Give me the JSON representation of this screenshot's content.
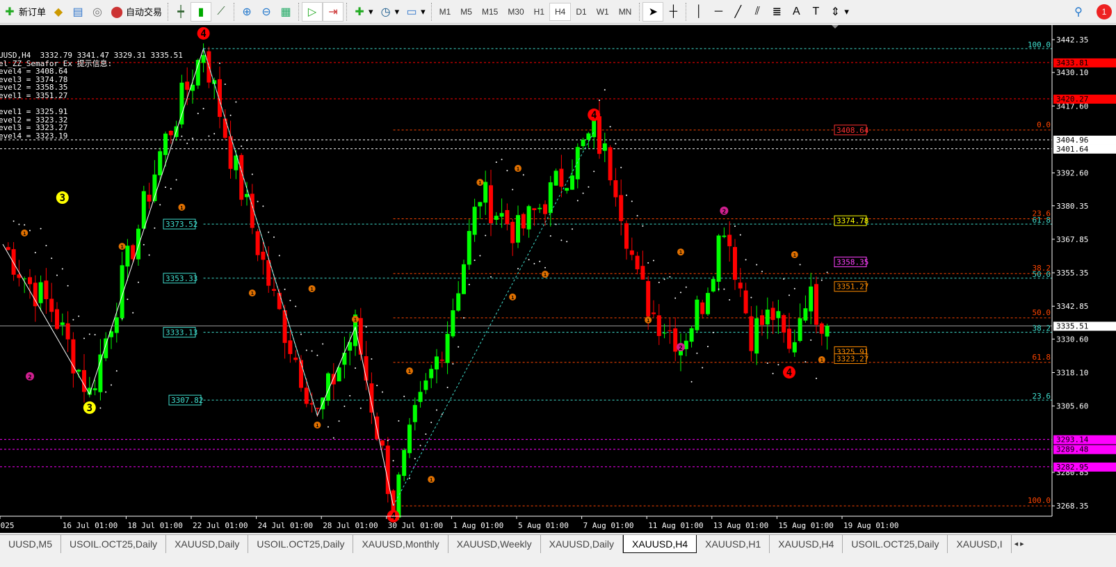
{
  "toolbar": {
    "new_order": "新订单",
    "auto_trading": "自动交易",
    "timeframes": [
      "M1",
      "M5",
      "M15",
      "M30",
      "H1",
      "H4",
      "D1",
      "W1",
      "MN"
    ],
    "active_timeframe": "H4",
    "notification_count": "1"
  },
  "info": {
    "header": "UUSD,H4  3332.79 3341.47 3329.31 3335.51",
    "indicator": "el_ZZ_Semafor_Ex 提示信息:",
    "lines": [
      "evel4 = 3408.64",
      "evel3 = 3374.78",
      "evel2 = 3358.35",
      "evel1 = 3351.27",
      "",
      "evel1 = 3325.91",
      "evel2 = 3323.32",
      "evel3 = 3323.27",
      "evel4 = 3323.19"
    ]
  },
  "colors": {
    "up": "#00ff00",
    "down": "#ff0000",
    "grid": "#ffffff",
    "fib_a": "#40e0d0",
    "fib_b": "#ff4500",
    "level_red": "#ff0000",
    "level_mag": "#ff00ff"
  },
  "chart_data": {
    "type": "candlestick",
    "symbol": "XAUUSD",
    "timeframe": "H4",
    "ylim": [
      3262,
      3448
    ],
    "price_ticks": [
      "3442.35",
      "3430.10",
      "3417.60",
      "3392.60",
      "3380.35",
      "3367.85",
      "3355.35",
      "3342.85",
      "3330.60",
      "3318.10",
      "3305.60",
      "3280.85",
      "3268.35"
    ],
    "time_labels": [
      [
        "2025",
        0
      ],
      [
        "16 Jul 01:00",
        11
      ],
      [
        "18 Jul 01:00",
        23
      ],
      [
        "22 Jul 01:00",
        35
      ],
      [
        "24 Jul 01:00",
        47
      ],
      [
        "28 Jul 01:00",
        59
      ],
      [
        "30 Jul 01:00",
        71
      ],
      [
        "1 Aug 01:00",
        83
      ],
      [
        "5 Aug 01:00",
        95
      ],
      [
        "7 Aug 01:00",
        107
      ],
      [
        "11 Aug 01:00",
        119
      ],
      [
        "13 Aug 01:00",
        131
      ],
      [
        "15 Aug 01:00",
        143
      ],
      [
        "19 Aug 01:00",
        155
      ]
    ],
    "zigzag_pivots": [
      [
        0,
        3366
      ],
      [
        5,
        3351
      ],
      [
        9,
        3342
      ],
      [
        16,
        3310
      ],
      [
        22,
        3352
      ],
      [
        29,
        3400
      ],
      [
        37,
        3439
      ],
      [
        42,
        3400
      ],
      [
        50,
        3345
      ],
      [
        58,
        3302
      ],
      [
        65,
        3335
      ],
      [
        72,
        3268.4
      ],
      [
        76,
        3300
      ],
      [
        82,
        3335
      ],
      [
        88,
        3385
      ],
      [
        95,
        3370
      ],
      [
        101,
        3385
      ],
      [
        109,
        3408
      ],
      [
        113,
        3390
      ],
      [
        117,
        3352
      ],
      [
        120,
        3340
      ],
      [
        125,
        3330
      ],
      [
        129,
        3345
      ],
      [
        133,
        3375
      ],
      [
        138,
        3333
      ],
      [
        142,
        3340
      ],
      [
        145,
        3325
      ],
      [
        148,
        3348
      ],
      [
        152,
        3335.5
      ]
    ],
    "last_ohlc": {
      "open": 3332.79,
      "high": 3341.47,
      "low": 3329.31,
      "close": 3335.51
    },
    "zigzag_line": [
      [
        0,
        3366
      ],
      [
        16,
        3310
      ],
      [
        37,
        3439
      ],
      [
        58,
        3302
      ],
      [
        65,
        3335
      ],
      [
        72,
        3268.4
      ]
    ],
    "zigzag_dashed": [
      [
        [
          37,
          3439
        ],
        [
          58,
          3302
        ]
      ],
      [
        [
          72,
          3268.4
        ],
        [
          109,
          3408
        ]
      ]
    ],
    "semafor": [
      [
        37,
        3444.7,
        "4",
        "#ff0000"
      ],
      [
        11,
        3383.4,
        "3",
        "#ffff00"
      ],
      [
        16,
        3305.0,
        "3",
        "#ffff00"
      ],
      [
        5,
        3316.7,
        "2",
        "#d02090"
      ],
      [
        125,
        3327.6,
        "2",
        "#d02090"
      ],
      [
        133,
        3378.5,
        "2",
        "#d02090"
      ],
      [
        109,
        3414.3,
        "4",
        "#ff0000"
      ],
      [
        145,
        3318.2,
        "4",
        "#ff0000"
      ],
      [
        72,
        3264.5,
        "4",
        "#ff0000"
      ],
      [
        4,
        3370.2,
        "1",
        "#e07000"
      ],
      [
        22,
        3365.2,
        "1",
        "#e07000"
      ],
      [
        33,
        3379.8,
        "1",
        "#e07000"
      ],
      [
        46,
        3347.8,
        "1",
        "#e07000"
      ],
      [
        57,
        3349.4,
        "1",
        "#e07000"
      ],
      [
        58,
        3298.5,
        "1",
        "#e07000"
      ],
      [
        65,
        3338.0,
        "1",
        "#e07000"
      ],
      [
        75,
        3318.7,
        "1",
        "#e07000"
      ],
      [
        79,
        3278.2,
        "1",
        "#e07000"
      ],
      [
        88,
        3389.1,
        "1",
        "#e07000"
      ],
      [
        95,
        3394.3,
        "1",
        "#e07000"
      ],
      [
        94,
        3346.3,
        "1",
        "#e07000"
      ],
      [
        100,
        3354.8,
        "1",
        "#e07000"
      ],
      [
        119,
        3337.7,
        "1",
        "#e07000"
      ],
      [
        125,
        3363.1,
        "1",
        "#e07000"
      ],
      [
        146,
        3362.1,
        "1",
        "#e07000"
      ],
      [
        151,
        3322.9,
        "1",
        "#e07000"
      ]
    ],
    "fib_cyan": {
      "start_bar": 37,
      "levels": [
        [
          "100.0",
          3439.0
        ],
        [
          "61.8",
          3373.52
        ],
        [
          "50.0",
          3353.33
        ],
        [
          "38.2",
          3333.13
        ],
        [
          "23.6",
          3307.82
        ]
      ]
    },
    "fib_orange": {
      "start_bar": 72,
      "levels": [
        [
          "0.0",
          3408.64
        ],
        [
          "23.6",
          3375.5
        ],
        [
          "38.2",
          3355.05
        ],
        [
          "50.0",
          3338.5
        ],
        [
          "61.8",
          3321.9
        ],
        [
          "100.0",
          3268.35
        ]
      ]
    },
    "left_boxes": [
      "3373.52",
      "3353.33",
      "3333.13",
      "3307.82"
    ],
    "right_boxes": [
      [
        "3408.64",
        "#ff3030"
      ],
      [
        "3374.78",
        "#ffff00"
      ],
      [
        "3358.35",
        "#ff40ff"
      ],
      [
        "3351.27",
        "#ff8c00"
      ],
      [
        "3325.91",
        "#ff8c00"
      ],
      [
        "3323.27",
        "#ff8c00"
      ]
    ],
    "levels": [
      [
        "3433.81",
        "#ff0000"
      ],
      [
        "3420.27",
        "#ff0000"
      ],
      [
        "3404.96",
        "#ffffff"
      ],
      [
        "3401.64",
        "#ffffff"
      ],
      [
        "3293.14",
        "#ff00ff"
      ],
      [
        "3289.48",
        "#ff00ff"
      ],
      [
        "3282.95",
        "#ff00ff"
      ]
    ],
    "current_price": "3335.51"
  },
  "tabs": [
    "UUSD,M5",
    "USOIL.OCT25,Daily",
    "XAUUSD,Daily",
    "USOIL.OCT25,Daily",
    "XAUUSD,Monthly",
    "XAUUSD,Weekly",
    "XAUUSD,Daily",
    "XAUUSD,H4",
    "XAUUSD,H1",
    "XAUUSD,H4",
    "USOIL.OCT25,Daily",
    "XAUUSD,I"
  ],
  "active_tab": 7
}
